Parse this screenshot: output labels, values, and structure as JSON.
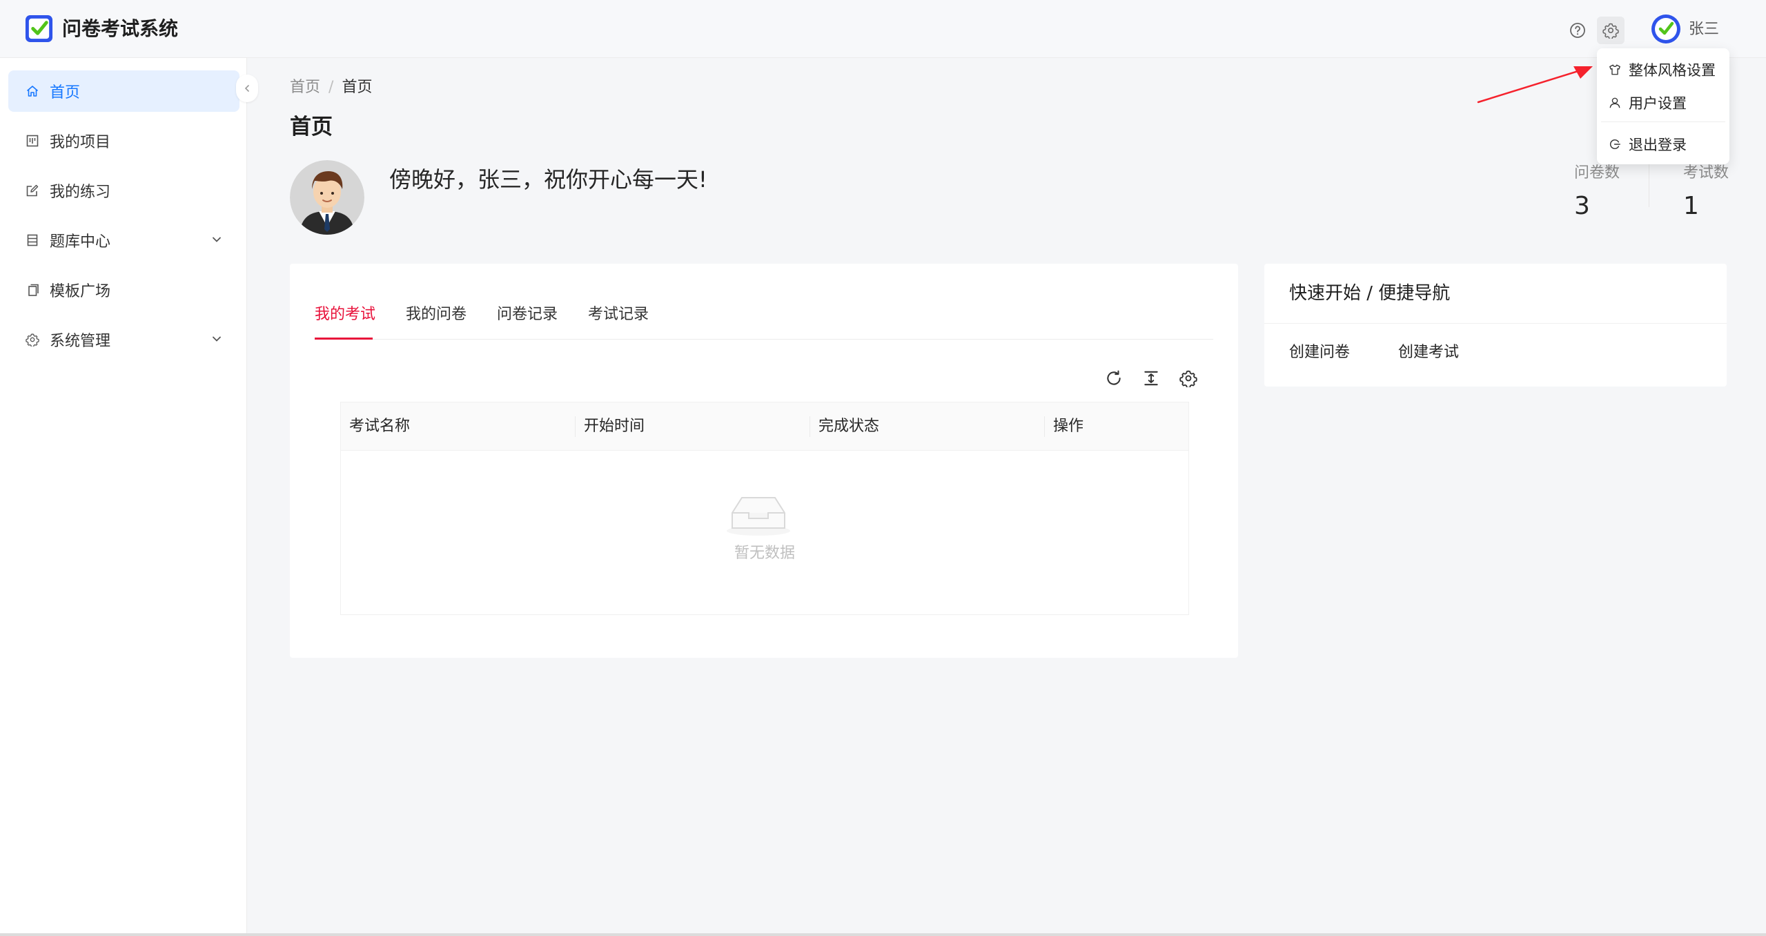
{
  "header": {
    "app_title": "问卷考试系统",
    "user_name": "张三",
    "icons": [
      "help-icon",
      "gear-icon"
    ]
  },
  "user_menu": {
    "items": [
      {
        "label": "整体风格设置",
        "icon": "shirt-icon"
      },
      {
        "label": "用户设置",
        "icon": "user-icon"
      },
      {
        "label": "退出登录",
        "icon": "logout-icon"
      }
    ]
  },
  "sidebar": {
    "items": [
      {
        "label": "首页",
        "icon": "home-icon",
        "active": true
      },
      {
        "label": "我的项目",
        "icon": "project-icon"
      },
      {
        "label": "我的练习",
        "icon": "edit-icon"
      },
      {
        "label": "题库中心",
        "icon": "database-icon",
        "expandable": true
      },
      {
        "label": "模板广场",
        "icon": "copy-icon"
      },
      {
        "label": "系统管理",
        "icon": "settings-icon",
        "expandable": true
      }
    ]
  },
  "breadcrumb": {
    "items": [
      "首页",
      "首页"
    ],
    "separator": "/"
  },
  "page": {
    "title": "首页",
    "greeting": "傍晚好，张三，祝你开心每一天!"
  },
  "stats": {
    "questionnaires": {
      "label": "问卷数",
      "value": "3"
    },
    "exams": {
      "label": "考试数",
      "value": "1"
    }
  },
  "exam_card": {
    "tabs": [
      "我的考试",
      "我的问卷",
      "问卷记录",
      "考试记录"
    ],
    "active_tab": 0,
    "columns": [
      "考试名称",
      "开始时间",
      "完成状态",
      "操作"
    ],
    "empty_text": "暂无数据"
  },
  "quick_card": {
    "title": "快速开始 / 便捷导航",
    "links": [
      "创建问卷",
      "创建考试"
    ]
  },
  "colors": {
    "accent": "#1677ff",
    "tab_active": "#e8113a",
    "annotation_arrow": "#f5222d"
  }
}
